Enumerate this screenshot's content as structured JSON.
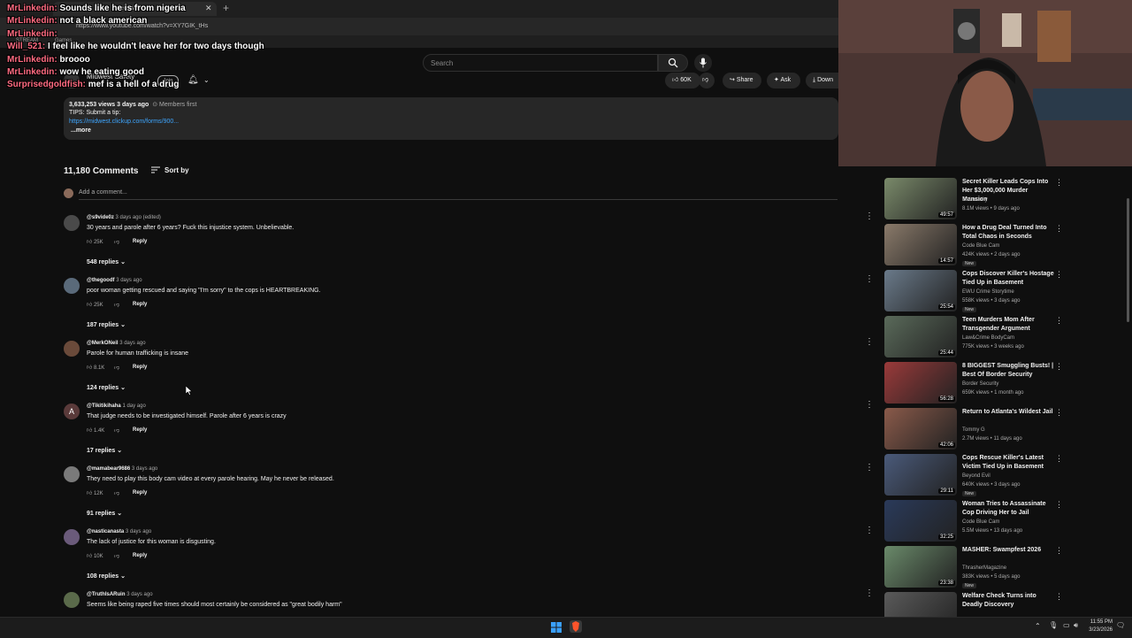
{
  "browser": {
    "tab_title": "...ed Wom...",
    "url": "https://www.youtube.com/watch?v=XY7GIK_tHs",
    "bookmarks": [
      "STREAM",
      "Games"
    ]
  },
  "yt_header": {
    "search_placeholder": "Search",
    "channel_name": "Midwest Safety",
    "join_label": "Join",
    "likes": "60K",
    "share_label": "Share",
    "ask_label": "Ask",
    "download_label": "Down"
  },
  "description": {
    "stats": "3,633,253 views  3 days ago",
    "members": "Members first",
    "tips": "TIPS: Submit a tip:",
    "link": "https://midwest.clickup.com/forms/900...",
    "more": "...more"
  },
  "comments": {
    "count_label": "11,180 Comments",
    "sort_label": "Sort by",
    "add_placeholder": "Add a comment...",
    "items": [
      {
        "author": "@s9vide0z",
        "meta": "3 days ago (edited)",
        "text": "30 years and parole after 6 years? Fuck this injustice system. Unbelievable.",
        "likes": "25K",
        "reply": "Reply",
        "replies": "548 replies",
        "avatar_color": "#4a4a4a"
      },
      {
        "author": "@thegoodf",
        "meta": "3 days ago",
        "text": "poor woman getting rescued and saying \"I'm sorry\" to the cops is HEARTBREAKING.",
        "likes": "25K",
        "reply": "Reply",
        "replies": "187 replies",
        "avatar_color": "#5a6a7a"
      },
      {
        "author": "@MerkONeil",
        "meta": "3 days ago",
        "text": "Parole for human trafficking is insane",
        "likes": "8.1K",
        "reply": "Reply",
        "replies": "124 replies",
        "avatar_color": "#6a4a3a"
      },
      {
        "author": "@Tikitikihaha",
        "meta": "1 day ago",
        "text": "That judge needs to be investigated himself. Parole after 6 years is crazy",
        "likes": "1.4K",
        "reply": "Reply",
        "replies": "17 replies",
        "avatar_color": "#5a3a3a",
        "initial": "A"
      },
      {
        "author": "@mamabear9686",
        "meta": "3 days ago",
        "text": "They need to play this body cam video at every parole hearing. May he never be released.",
        "likes": "12K",
        "reply": "Reply",
        "replies": "91 replies",
        "avatar_color": "#7a7a7a"
      },
      {
        "author": "@nasticanasta",
        "meta": "3 days ago",
        "text": "The lack of justice for this woman is disgusting.",
        "likes": "10K",
        "reply": "Reply",
        "replies": "108 replies",
        "avatar_color": "#6a5a7a"
      },
      {
        "author": "@TruthIsARuin",
        "meta": "3 days ago",
        "text": "Seems like being raped five times should most certainly be considered as \"great bodily harm\"",
        "likes": "",
        "reply": "",
        "replies": "",
        "avatar_color": "#5a6a4a"
      }
    ]
  },
  "sidebar": {
    "items": [
      {
        "title": "Secret Killer Leads Cops Into Her $3,000,000 Murder Mansion",
        "channel": "Dr Insanity",
        "meta": "8.1M views • 9 days ago",
        "duration": "49:57",
        "new": false,
        "thumb": "#7a8a6a"
      },
      {
        "title": "How a Drug Deal Turned Into Total Chaos in Seconds",
        "channel": "Code Blue Cam",
        "meta": "424K views • 2 days ago",
        "duration": "14:57",
        "new": true,
        "thumb": "#8a7a6a"
      },
      {
        "title": "Cops Discover Killer's Hostage Tied Up in Basement",
        "channel": "EWU Crime Storytime",
        "meta": "558K views • 3 days ago",
        "duration": "25:54",
        "new": true,
        "thumb": "#6a7a8a"
      },
      {
        "title": "Teen Murders Mom After Transgender Argument",
        "channel": "Law&Crime BodyCam",
        "meta": "775K views • 3 weeks ago",
        "duration": "25:44",
        "new": false,
        "thumb": "#5a6a5a"
      },
      {
        "title": "8 BIGGEST Smuggling Busts! | Best Of Border Security",
        "channel": "Border Security",
        "meta": "659K views • 1 month ago",
        "duration": "56:28",
        "new": false,
        "thumb": "#9a3a3a"
      },
      {
        "title": "Return to Atlanta's Wildest Jail",
        "channel": "Tommy G",
        "meta": "2.7M views • 11 days ago",
        "duration": "42:06",
        "new": false,
        "thumb": "#8a5a4a"
      },
      {
        "title": "Cops Rescue Killer's Latest Victim Tied Up in Basement",
        "channel": "Beyond Evil",
        "meta": "640K views • 3 days ago",
        "duration": "29:11",
        "new": true,
        "thumb": "#4a5a7a"
      },
      {
        "title": "Woman Tries to Assassinate Cop Driving Her to Jail",
        "channel": "Code Blue Cam",
        "meta": "5.5M views • 13 days ago",
        "duration": "32:25",
        "new": false,
        "thumb": "#2a3a5a"
      },
      {
        "title": "MASHER: Swampfest 2026",
        "channel": "ThrasherMagazine",
        "meta": "383K views • 5 days ago",
        "duration": "23:38",
        "new": true,
        "thumb": "#6a8a6a"
      },
      {
        "title": "Welfare Check Turns into Deadly Discovery",
        "channel": "",
        "meta": "",
        "duration": "",
        "new": false,
        "thumb": "#5a5a5a"
      }
    ]
  },
  "chat": [
    {
      "user": "MrLinkedin:",
      "message": "Sounds like he is from nigeria"
    },
    {
      "user": "MrLinkedin:",
      "message": "not a black american"
    },
    {
      "user": "MrLinkedin:",
      "message": ""
    },
    {
      "user": "Will_521:",
      "message": "I feel like he wouldn't leave her for two days though"
    },
    {
      "user": "MrLinkedin:",
      "message": "broooo"
    },
    {
      "user": "MrLinkedin:",
      "message": "wow he eating good"
    },
    {
      "user": "Surprisedgoldfish:",
      "message": "mef is a hell of a drug"
    }
  ],
  "taskbar": {
    "time": "11:55 PM",
    "date": "3/23/2026"
  },
  "colors": {
    "bg": "#0f0f0f",
    "link": "#3ea6ff",
    "chat_user": "#ff6b81"
  }
}
